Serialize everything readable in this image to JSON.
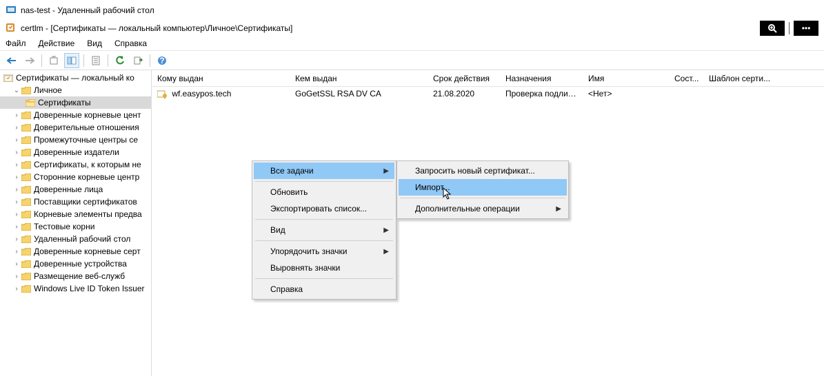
{
  "window": {
    "title": "nas-test - Удаленный рабочий стол",
    "subtitle": "certlm - [Сертификаты — локальный компьютер\\Личное\\Сертификаты]"
  },
  "menubar": {
    "file": "Файл",
    "action": "Действие",
    "view": "Вид",
    "help": "Справка"
  },
  "tree": {
    "root": "Сертификаты — локальный ко",
    "personal": "Личное",
    "certs": "Сертификаты",
    "n1": "Доверенные корневые цент",
    "n2": "Доверительные отношения",
    "n3": "Промежуточные центры се",
    "n4": "Доверенные издатели",
    "n5": "Сертификаты, к которым не",
    "n6": "Сторонние корневые центр",
    "n7": "Доверенные лица",
    "n8": "Поставщики сертификатов",
    "n9": "Корневые элементы предва",
    "n10": "Тестовые корни",
    "n11": "Удаленный рабочий стол",
    "n12": "Доверенные корневые серт",
    "n13": "Доверенные устройства",
    "n14": "Размещение веб-служб",
    "n15": "Windows Live ID Token Issuer"
  },
  "columns": {
    "issued_to": "Кому выдан",
    "issued_by": "Кем выдан",
    "expires": "Срок действия",
    "purposes": "Назначения",
    "name": "Имя",
    "status": "Сост...",
    "template": "Шаблон серти..."
  },
  "rows": [
    {
      "issued_to": "wf.easypos.tech",
      "issued_by": "GoGetSSL RSA DV CA",
      "expires": "21.08.2020",
      "purposes": "Проверка подлин...",
      "name": "<Нет>"
    }
  ],
  "context_menu_1": {
    "all_tasks": "Все задачи",
    "refresh": "Обновить",
    "export_list": "Экспортировать список...",
    "view": "Вид",
    "arrange_icons": "Упорядочить значки",
    "align_icons": "Выровнять значки",
    "help": "Справка"
  },
  "context_menu_2": {
    "request_new": "Запросить новый сертификат...",
    "import": "Импорт...",
    "additional": "Дополнительные операции"
  },
  "toolbar_buttons": {
    "zoom": "zoom",
    "more": "•••"
  }
}
